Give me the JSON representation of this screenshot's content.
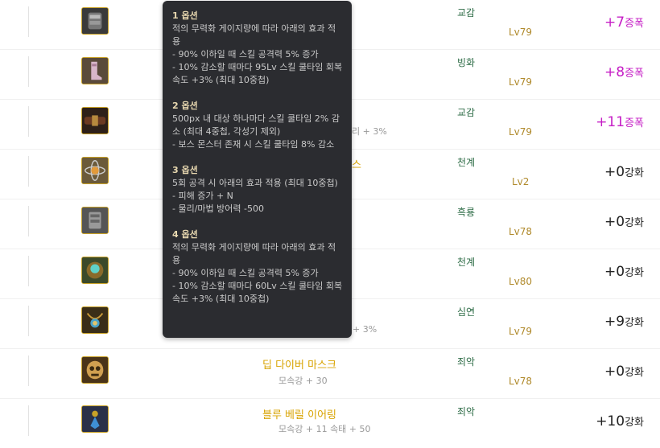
{
  "rows": [
    {
      "set": "교감",
      "level": "Lv79",
      "enh_value": "+7",
      "enh_unit": "증폭",
      "amp": true,
      "icon": "armor-icon"
    },
    {
      "set": "빙화",
      "level": "Lv79",
      "enh_value": "+8",
      "enh_unit": "증폭",
      "amp": true,
      "icon": "boots-icon"
    },
    {
      "set": "교감",
      "level": "Lv79",
      "enh_value": "+11",
      "enh_unit": "증폭",
      "amp": true,
      "icon": "belt-icon",
      "peek": "리 + 3%"
    },
    {
      "set": "천계",
      "level": "Lv2",
      "enh_value": "+0",
      "enh_unit": "강화",
      "amp": false,
      "icon": "atom-orb-icon",
      "peek": "스"
    },
    {
      "set": "흑룡",
      "level": "Lv78",
      "enh_value": "+0",
      "enh_unit": "강화",
      "amp": false,
      "icon": "gauntlet-icon"
    },
    {
      "set": "천계",
      "level": "Lv80",
      "enh_value": "+0",
      "enh_unit": "강화",
      "amp": false,
      "icon": "gem-bracelet-icon"
    },
    {
      "set": "심연",
      "level": "Lv79",
      "enh_value": "+9",
      "enh_unit": "강화",
      "amp": false,
      "icon": "gem-necklace-icon",
      "peek": "+ 3%"
    },
    {
      "set": "죄악",
      "level": "Lv78",
      "enh_value": "+0",
      "enh_unit": "강화",
      "amp": false,
      "icon": "mask-icon",
      "name": "딥 다이버 마스크",
      "sub": "모속강 + 30"
    },
    {
      "set": "죄악",
      "level": "",
      "enh_value": "+10",
      "enh_unit": "강화",
      "amp": false,
      "icon": "earring-icon",
      "name": "블루 베릴 이어링",
      "sub": "모속강 + 11 속태 + 50"
    }
  ],
  "tooltip": {
    "options": [
      {
        "title": "1 옵션",
        "lines": [
          " 적의 무력화 게이지량에 따라 아래의 효과 적용",
          "- 90% 이하일 때 스킬 공격력 5% 증가",
          "- 10% 감소할 때마다 95Lv 스킬 쿨타임 회복 속도 +3% (최대 10중첩)"
        ]
      },
      {
        "title": "2 옵션",
        "lines": [
          " 500px 내 대상 하나마다 스킬 쿨타임 2% 감소 (최대 4중첩, 각성기 제외)",
          "- 보스 몬스터 존재 시 스킬 쿨타임 8% 감소"
        ]
      },
      {
        "title": "3 옵션",
        "lines": [
          " 5회 공격 시 아래의 효과 적용 (최대 10중첩)",
          "- 피해 증가 + N",
          "- 물리/마법 방어력 -500"
        ]
      },
      {
        "title": "4 옵션",
        "lines": [
          " 적의 무력화 게이지량에 따라 아래의 효과 적용",
          "- 90% 이하일 때 스킬 공격력 5% 증가",
          "- 10% 감소할 때마다 60Lv 스킬 쿨타임 회복 속도 +3% (최대 10중첩)"
        ]
      }
    ]
  }
}
